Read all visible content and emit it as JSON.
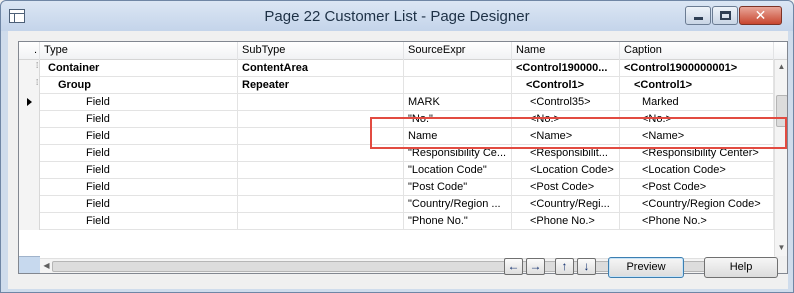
{
  "window": {
    "title": "Page 22 Customer List - Page Designer",
    "close_glyph": "✕"
  },
  "grid": {
    "columns": [
      {
        "key": "indicator",
        "label": "."
      },
      {
        "key": "type",
        "label": "Type"
      },
      {
        "key": "subtype",
        "label": "SubType"
      },
      {
        "key": "sourceexpr",
        "label": "SourceExpr"
      },
      {
        "key": "name",
        "label": "Name"
      },
      {
        "key": "caption",
        "label": "Caption"
      }
    ],
    "rows": [
      {
        "type": "Container",
        "subtype": "ContentArea",
        "sourceexpr": "",
        "name": "<Control190000...",
        "caption": "<Control1900000001>",
        "bold": true
      },
      {
        "type": "Group",
        "subtype": "Repeater",
        "sourceexpr": "",
        "name": "<Control1>",
        "caption": "<Control1>",
        "bold": true
      },
      {
        "type": "Field",
        "subtype": "",
        "sourceexpr": "MARK",
        "name": "<Control35>",
        "caption": "Marked",
        "bold": false,
        "current": true
      },
      {
        "type": "Field",
        "subtype": "",
        "sourceexpr": "\"No.\"",
        "name": "<No.>",
        "caption": "<No.>",
        "bold": false
      },
      {
        "type": "Field",
        "subtype": "",
        "sourceexpr": "Name",
        "name": "<Name>",
        "caption": "<Name>",
        "bold": false
      },
      {
        "type": "Field",
        "subtype": "",
        "sourceexpr": "\"Responsibility Ce...",
        "name": "<Responsibilit...",
        "caption": "<Responsibility Center>",
        "bold": false
      },
      {
        "type": "Field",
        "subtype": "",
        "sourceexpr": "\"Location Code\"",
        "name": "<Location Code>",
        "caption": "<Location Code>",
        "bold": false
      },
      {
        "type": "Field",
        "subtype": "",
        "sourceexpr": "\"Post Code\"",
        "name": "<Post Code>",
        "caption": "<Post Code>",
        "bold": false
      },
      {
        "type": "Field",
        "subtype": "",
        "sourceexpr": "\"Country/Region ...",
        "name": "<Country/Regi...",
        "caption": "<Country/Region Code>",
        "bold": false
      },
      {
        "type": "Field",
        "subtype": "",
        "sourceexpr": "\"Phone No.\"",
        "name": "<Phone No.>",
        "caption": "<Phone No.>",
        "bold": false
      }
    ]
  },
  "nav": {
    "left": "←",
    "right": "→",
    "up": "↑",
    "down": "↓"
  },
  "buttons": {
    "preview": "Preview",
    "help": "Help"
  },
  "colors": {
    "highlight_box": "#e24b41",
    "title_bar": "#c4d4ea"
  }
}
